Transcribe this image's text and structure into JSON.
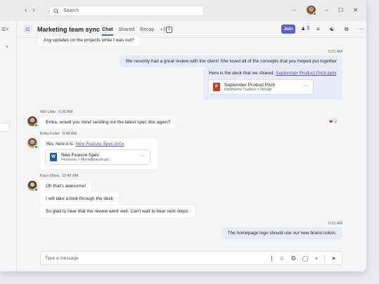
{
  "titlebar": {
    "search_placeholder": "Search",
    "back_icon": "chevron-left-icon",
    "forward_icon": "chevron-right-icon",
    "more_label": "···",
    "minimize_label": "–",
    "maximize_label": "☐",
    "close_label": "✕"
  },
  "chat": {
    "title": "Marketing team sync",
    "tabs": [
      {
        "label": "Chat",
        "active": true
      },
      {
        "label": "Shared"
      },
      {
        "label": "Recap"
      },
      {
        "label": "+3"
      }
    ],
    "join_label": "Join",
    "participants_count": "3"
  },
  "messages": {
    "cut_text": "Any updates on the projects while I was out?",
    "m1_time": "9:21 AM",
    "m1_text": "We recently had a great review with the client! She loved all of the concepts that you helped put together",
    "m2_text_prefix": "Here is the deck that we shared: ",
    "m2_link": "September Product Pitch.pptx",
    "m2_file_name": "September Product Pitch",
    "m2_file_path": "Northwind Traders > Design",
    "m2_reaction_count": "2",
    "will_name": "Will Little",
    "will_time": "9:30 AM",
    "will_mention": "Erika",
    "will_text": ", would you mind sending me the latest spec doc again?",
    "erika_name": "Erika Fuller",
    "erika_time": "9:48 AM",
    "erika_text_prefix": "Yes, here it is: ",
    "erika_link": "New Feature Spec.docx",
    "erika_file_name": "New Feature Spec",
    "erika_file_path": "Personal > MarieBeaudouin",
    "kayo_name": "Kayo Miwa",
    "kayo_time": "10:42 AM",
    "kayo_text1": "Oh that's awesome!",
    "kayo_text2": "I will take a look through the deck",
    "kayo_text3": "So glad to hear that the review went well. Can't wait to hear next steps.",
    "m_last_time": "9:21 AM",
    "m_last_text": "The homepage logo should use our new brand colors."
  },
  "composer": {
    "placeholder": "Type a message"
  },
  "colors": {
    "accent": "#5b5fc7",
    "my_bubble": "#e8ebfa",
    "presence": "#13a10e"
  }
}
